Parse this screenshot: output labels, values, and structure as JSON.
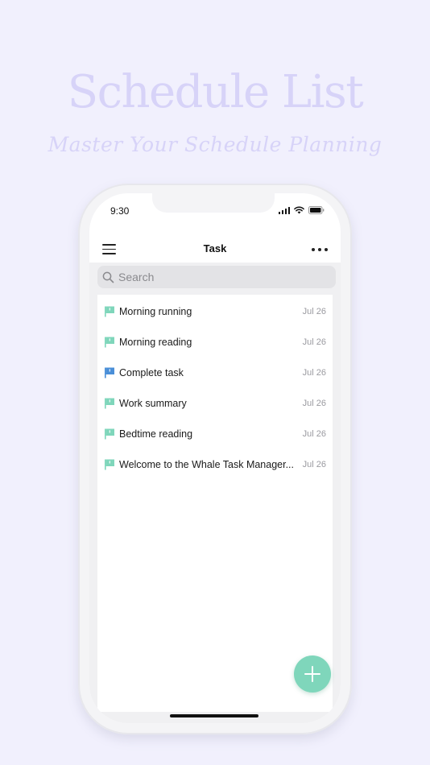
{
  "promo": {
    "title": "Schedule List",
    "subtitle": "Master Your Schedule Planning"
  },
  "status_bar": {
    "time": "9:30"
  },
  "nav": {
    "title": "Task",
    "menu_icon": "hamburger-icon",
    "more_icon": "more-icon"
  },
  "search": {
    "placeholder": "Search",
    "icon": "search-icon"
  },
  "tasks": [
    {
      "title": "Morning running",
      "date": "Jul 26",
      "flag_color": "#7fd6bb"
    },
    {
      "title": "Morning reading",
      "date": "Jul 26",
      "flag_color": "#7fd6bb"
    },
    {
      "title": "Complete task",
      "date": "Jul 26",
      "flag_color": "#4a8fd8"
    },
    {
      "title": "Work summary",
      "date": "Jul 26",
      "flag_color": "#7fd6bb"
    },
    {
      "title": "Bedtime reading",
      "date": "Jul 26",
      "flag_color": "#7fd6bb"
    },
    {
      "title": "Welcome to the Whale Task Manager...",
      "date": "Jul 26",
      "flag_color": "#7fd6bb"
    }
  ],
  "fab": {
    "icon": "plus-icon"
  },
  "colors": {
    "background": "#f1f0fd",
    "accent": "#7fd6bb",
    "promo_text": "#d7d3f8"
  }
}
